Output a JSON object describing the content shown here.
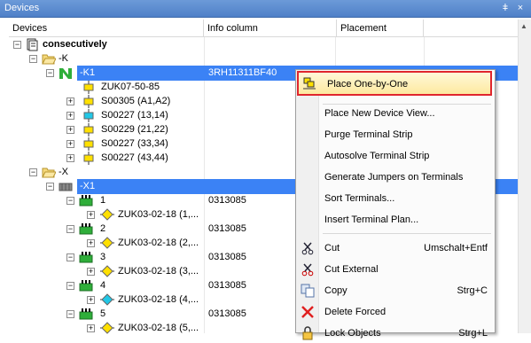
{
  "window": {
    "title": "Devices",
    "pin_glyph": "ǂ",
    "close_glyph": "×"
  },
  "columns": {
    "devices": "Devices",
    "info": "Info column",
    "placement": "Placement"
  },
  "tree": {
    "root": "consecutively",
    "k_folder": "-K",
    "k1": {
      "label": "-K1",
      "info": "3RH11311BF40"
    },
    "k1_children": [
      "ZUK07-50-85",
      "S00305 (A1,A2)",
      "S00227 (13,14)",
      "S00229 (21,22)",
      "S00227 (33,34)",
      "S00227 (43,44)"
    ],
    "x_folder": "-X",
    "x1": {
      "label": "-X1"
    },
    "terminals": [
      {
        "num": "1",
        "info": "0313085",
        "child": "ZUK03-02-18 (1,..."
      },
      {
        "num": "2",
        "info": "0313085",
        "child": "ZUK03-02-18 (2,..."
      },
      {
        "num": "3",
        "info": "0313085",
        "child": "ZUK03-02-18 (3,..."
      },
      {
        "num": "4",
        "info": "0313085",
        "child": "ZUK03-02-18 (4,..."
      },
      {
        "num": "5",
        "info": "0313085",
        "child": "ZUK03-02-18 (5,..."
      }
    ]
  },
  "menu": {
    "place_one_by_one": "Place One-by-One",
    "place_new_view": "Place New Device View...",
    "purge": "Purge Terminal Strip",
    "autosolve": "Autosolve Terminal Strip",
    "generate_jumpers": "Generate Jumpers on Terminals",
    "sort": "Sort Terminals...",
    "insert_plan": "Insert Terminal Plan...",
    "cut": "Cut",
    "cut_shortcut": "Umschalt+Entf",
    "cut_external": "Cut External",
    "copy": "Copy",
    "copy_shortcut": "Strg+C",
    "delete_forced": "Delete Forced",
    "lock_objects": "Lock Objects",
    "lock_shortcut": "Strg+L"
  },
  "colors": {
    "selection": "#3b82f5",
    "highlight_border": "#e0262e",
    "titlebar": "#5a8bd0"
  }
}
